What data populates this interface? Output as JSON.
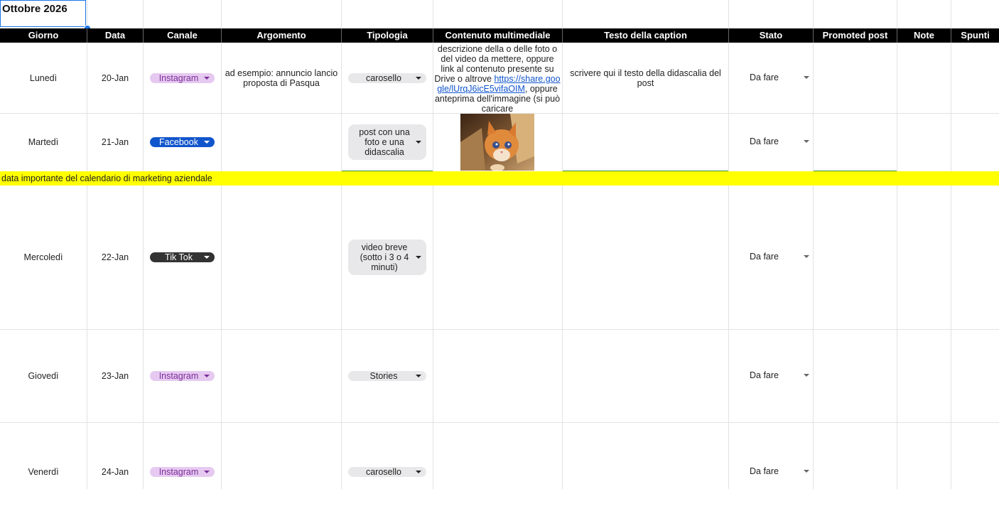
{
  "sheet": {
    "title": "Ottobre 2026"
  },
  "header": {
    "giorno": "Giorno",
    "data": "Data",
    "canale": "Canale",
    "argomento": "Argomento",
    "tipologia": "Tipologia",
    "contenuto": "Contenuto multimediale",
    "testo": "Testo della caption",
    "stato": "Stato",
    "promoted": "Promoted post",
    "note": "Note",
    "spunti": "Spunti"
  },
  "rows": [
    {
      "giorno": "Lunedì",
      "data": "20-Jan",
      "canale": "Instagram",
      "argomento": "ad esempio: annuncio lancio proposta di Pasqua",
      "tipologia": "carosello",
      "contenuto_pre": "descrizione della o delle foto o del video da mettere, oppure link al contenuto presente su Drive o altrove ",
      "contenuto_link": "https://share.google/lUrqJ6icE5vifaOIM",
      "contenuto_post": ", oppure anteprima dell'immagine (si può caricare",
      "testo": "scrivere qui il testo della didascalia del post",
      "stato": "Da fare"
    },
    {
      "giorno": "Martedì",
      "data": "21-Jan",
      "canale": "Facebook",
      "tipologia": "post con una foto e una didascalia",
      "stato": "Da fare"
    },
    {
      "giorno": "Mercoledì",
      "data": "22-Jan",
      "canale": "Tik Tok",
      "tipologia": "video breve (sotto i 3 o 4 minuti)",
      "stato": "Da fare"
    },
    {
      "giorno": "Giovedì",
      "data": "23-Jan",
      "canale": "Instagram",
      "tipologia": "Stories",
      "stato": "Da fare"
    },
    {
      "giorno": "Venerdì",
      "data": "24-Jan",
      "canale": "Instagram",
      "tipologia": "carosello",
      "stato": "Da fare"
    }
  ],
  "highlight": {
    "text": "data importante del calendario di marketing aziendale",
    "color": "#ffff00"
  },
  "colors": {
    "instagram_chip": "#e6c9f0",
    "facebook_chip": "#1155cc",
    "tiktok_chip": "#333333",
    "header_bg": "#000000",
    "selection": "#1a73e8"
  }
}
